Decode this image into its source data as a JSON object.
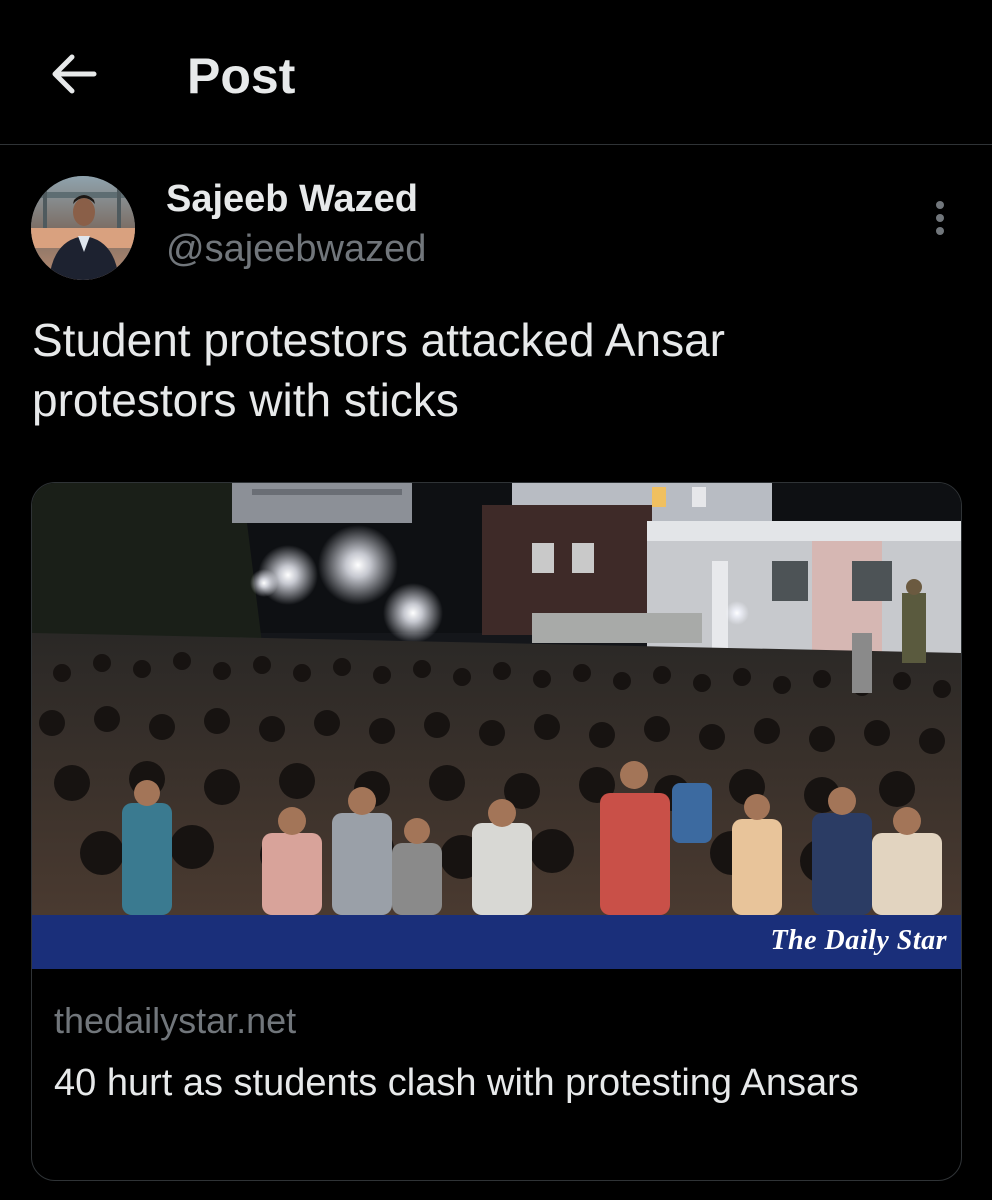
{
  "header": {
    "back_icon": "arrow-left-icon",
    "title": "Post"
  },
  "author": {
    "name": "Sajeeb Wazed",
    "handle": "@sajeebwazed",
    "more_icon": "more-vertical-icon"
  },
  "tweet": {
    "text": "Student protestors attacked Ansar protestors with sticks"
  },
  "card": {
    "banner_logo": "The Daily Star",
    "domain": "thedailystar.net",
    "title": "40 hurt as students clash with protesting Ansars"
  },
  "colors": {
    "background": "#000000",
    "text_primary": "#e7e9ea",
    "text_secondary": "#71767b",
    "border": "#2f3336",
    "banner": "#1a2f7a"
  }
}
